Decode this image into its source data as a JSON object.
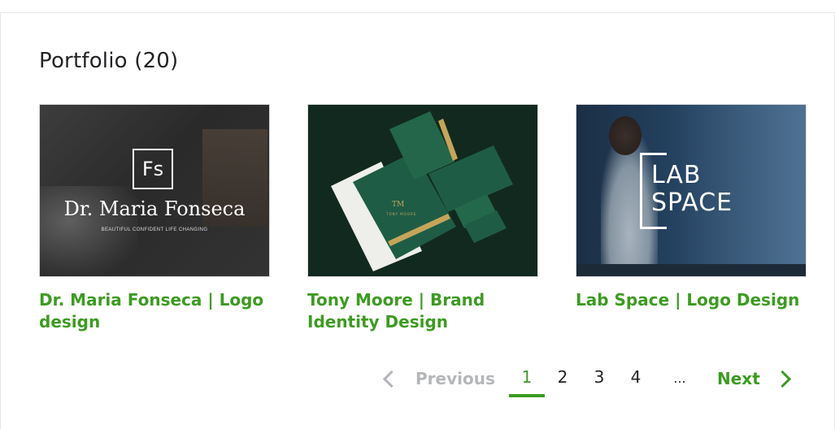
{
  "section": {
    "title": "Portfolio (20)"
  },
  "cards": [
    {
      "caption": "Dr. Maria Fonseca | Logo design",
      "image": {
        "monogram": "Fs",
        "name": "Dr. Maria Fonseca",
        "tagline": "BEAUTIFUL CONFIDENT LIFE CHANGING"
      }
    },
    {
      "caption": "Tony Moore | Brand Identity Design",
      "image": {
        "monogram": "TM",
        "brand": "TONY MOORE"
      }
    },
    {
      "caption": "Lab Space | Logo Design",
      "image": {
        "line1": "LAB",
        "line2": "SPACE"
      }
    }
  ],
  "pagination": {
    "previous_label": "Previous",
    "pages": [
      "1",
      "2",
      "3",
      "4",
      "..."
    ],
    "current_page": "1",
    "next_label": "Next"
  },
  "colors": {
    "accent": "#3d9b22",
    "text": "#222325",
    "disabled": "#b5b6ba",
    "border": "#dadbdd"
  }
}
